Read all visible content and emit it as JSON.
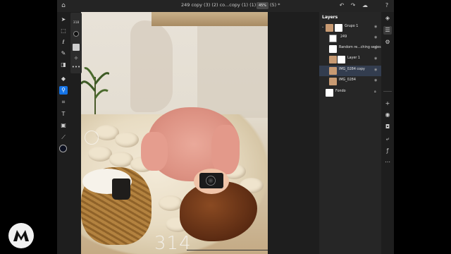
{
  "app": {
    "document_title": "249 copy (3) (2) co...copy (1) (1) copy (5) *",
    "zoom": "45%",
    "icons": {
      "home": "home-icon",
      "undo": "undo-icon",
      "redo": "redo-icon",
      "cloud": "cloud-icon",
      "help": "help-icon"
    }
  },
  "left_toolbar": {
    "tools": [
      "move-tool",
      "marquee-tool",
      "lasso-tool",
      "brush-tool",
      "eraser-tool",
      "fill-tool",
      "clone-stamp-tool",
      "crop-tool",
      "type-tool",
      "image-tool",
      "eyedropper-tool"
    ],
    "active_tool": "clone-stamp-tool",
    "foreground_color": "#0c1020"
  },
  "brush_panel": {
    "size": "318"
  },
  "canvas": {
    "overlay_number": "314"
  },
  "layers_panel": {
    "title": "Layers",
    "layers": [
      {
        "name": "Grupo 1",
        "type": "group",
        "indent": 0,
        "selected": false,
        "visible": true
      },
      {
        "name": "249",
        "type": "layer",
        "indent": 1,
        "selected": false,
        "visible": true
      },
      {
        "name": "Random re...ching series",
        "type": "layer",
        "indent": 1,
        "selected": false,
        "visible": true
      },
      {
        "name": "Layer 1",
        "type": "layer",
        "indent": 1,
        "selected": false,
        "visible": true
      },
      {
        "name": "IMG_0284 copy",
        "type": "layer",
        "indent": 1,
        "selected": true,
        "visible": true
      },
      {
        "name": "IMG_0284",
        "type": "layer",
        "indent": 1,
        "selected": false,
        "visible": true
      },
      {
        "name": "Fondo",
        "type": "layer",
        "indent": 0,
        "selected": false,
        "visible": true,
        "locked": true
      }
    ]
  },
  "right_toolbar": {
    "tools": [
      "layers-icon",
      "layer-properties-icon",
      "adjustments-icon",
      "add-layer-icon",
      "visibility-icon",
      "mask-icon",
      "clip-icon",
      "fx-icon",
      "more-icon"
    ]
  },
  "colors": {
    "accent": "#1473e6",
    "panel_bg": "#262626",
    "selected_row": "#333d4f"
  }
}
